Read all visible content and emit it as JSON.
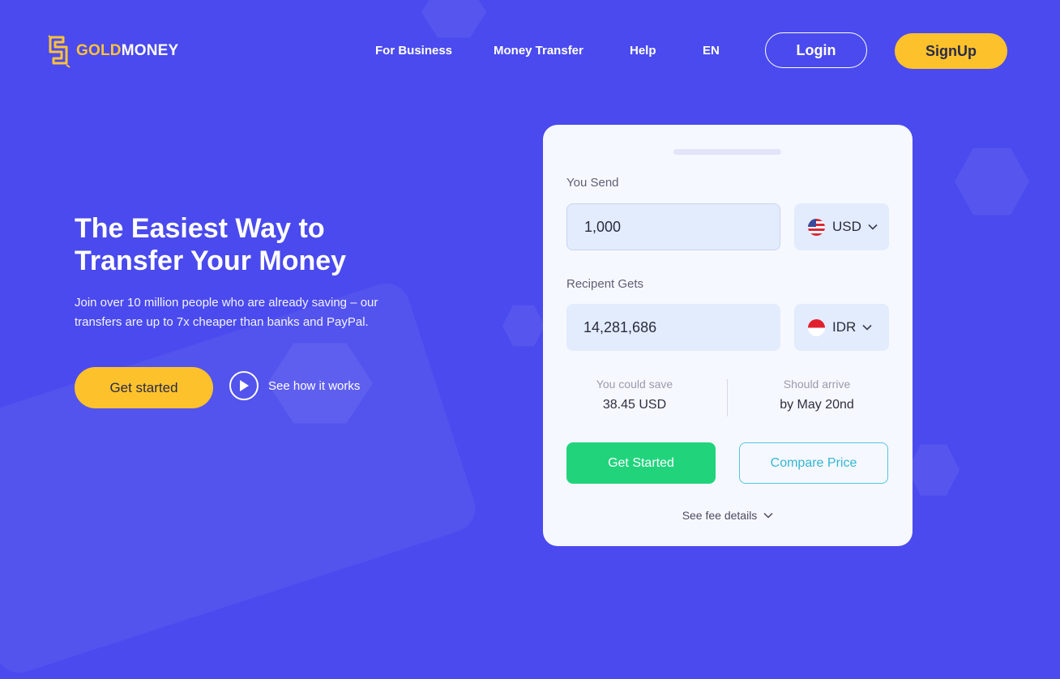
{
  "brand": {
    "name_part1": "GOLD",
    "name_part2": "MONEY",
    "gold_color": "#fdc23a"
  },
  "nav": {
    "items": [
      {
        "label": "For Business"
      },
      {
        "label": "Money Transfer"
      },
      {
        "label": "Help"
      },
      {
        "label": "EN"
      }
    ],
    "login_label": "Login",
    "signup_label": "SignUp"
  },
  "hero": {
    "title_line1": "The Easiest Way to",
    "title_line2": "Transfer Your Money",
    "subtitle": "Join over 10 million people who are already saving – our transfers are up to 7x cheaper than banks and PayPal.",
    "cta_label": "Get started",
    "video_label": "See how it works"
  },
  "converter": {
    "send_label": "You Send",
    "send_amount": "1,000",
    "send_currency": "USD",
    "receive_label": "Recipent Gets",
    "receive_amount": "14,281,686",
    "receive_currency": "IDR",
    "save_label": "You could save",
    "save_value": "38.45 USD",
    "arrive_label": "Should arrive",
    "arrive_value": "by May 20nd",
    "start_label": "Get Started",
    "compare_label": "Compare Price",
    "fee_details_label": "See fee details"
  },
  "colors": {
    "background": "#4a4aee",
    "accent_yellow": "#fdc22b",
    "success_green": "#21d47c",
    "compare_cyan": "#34b6d3"
  }
}
